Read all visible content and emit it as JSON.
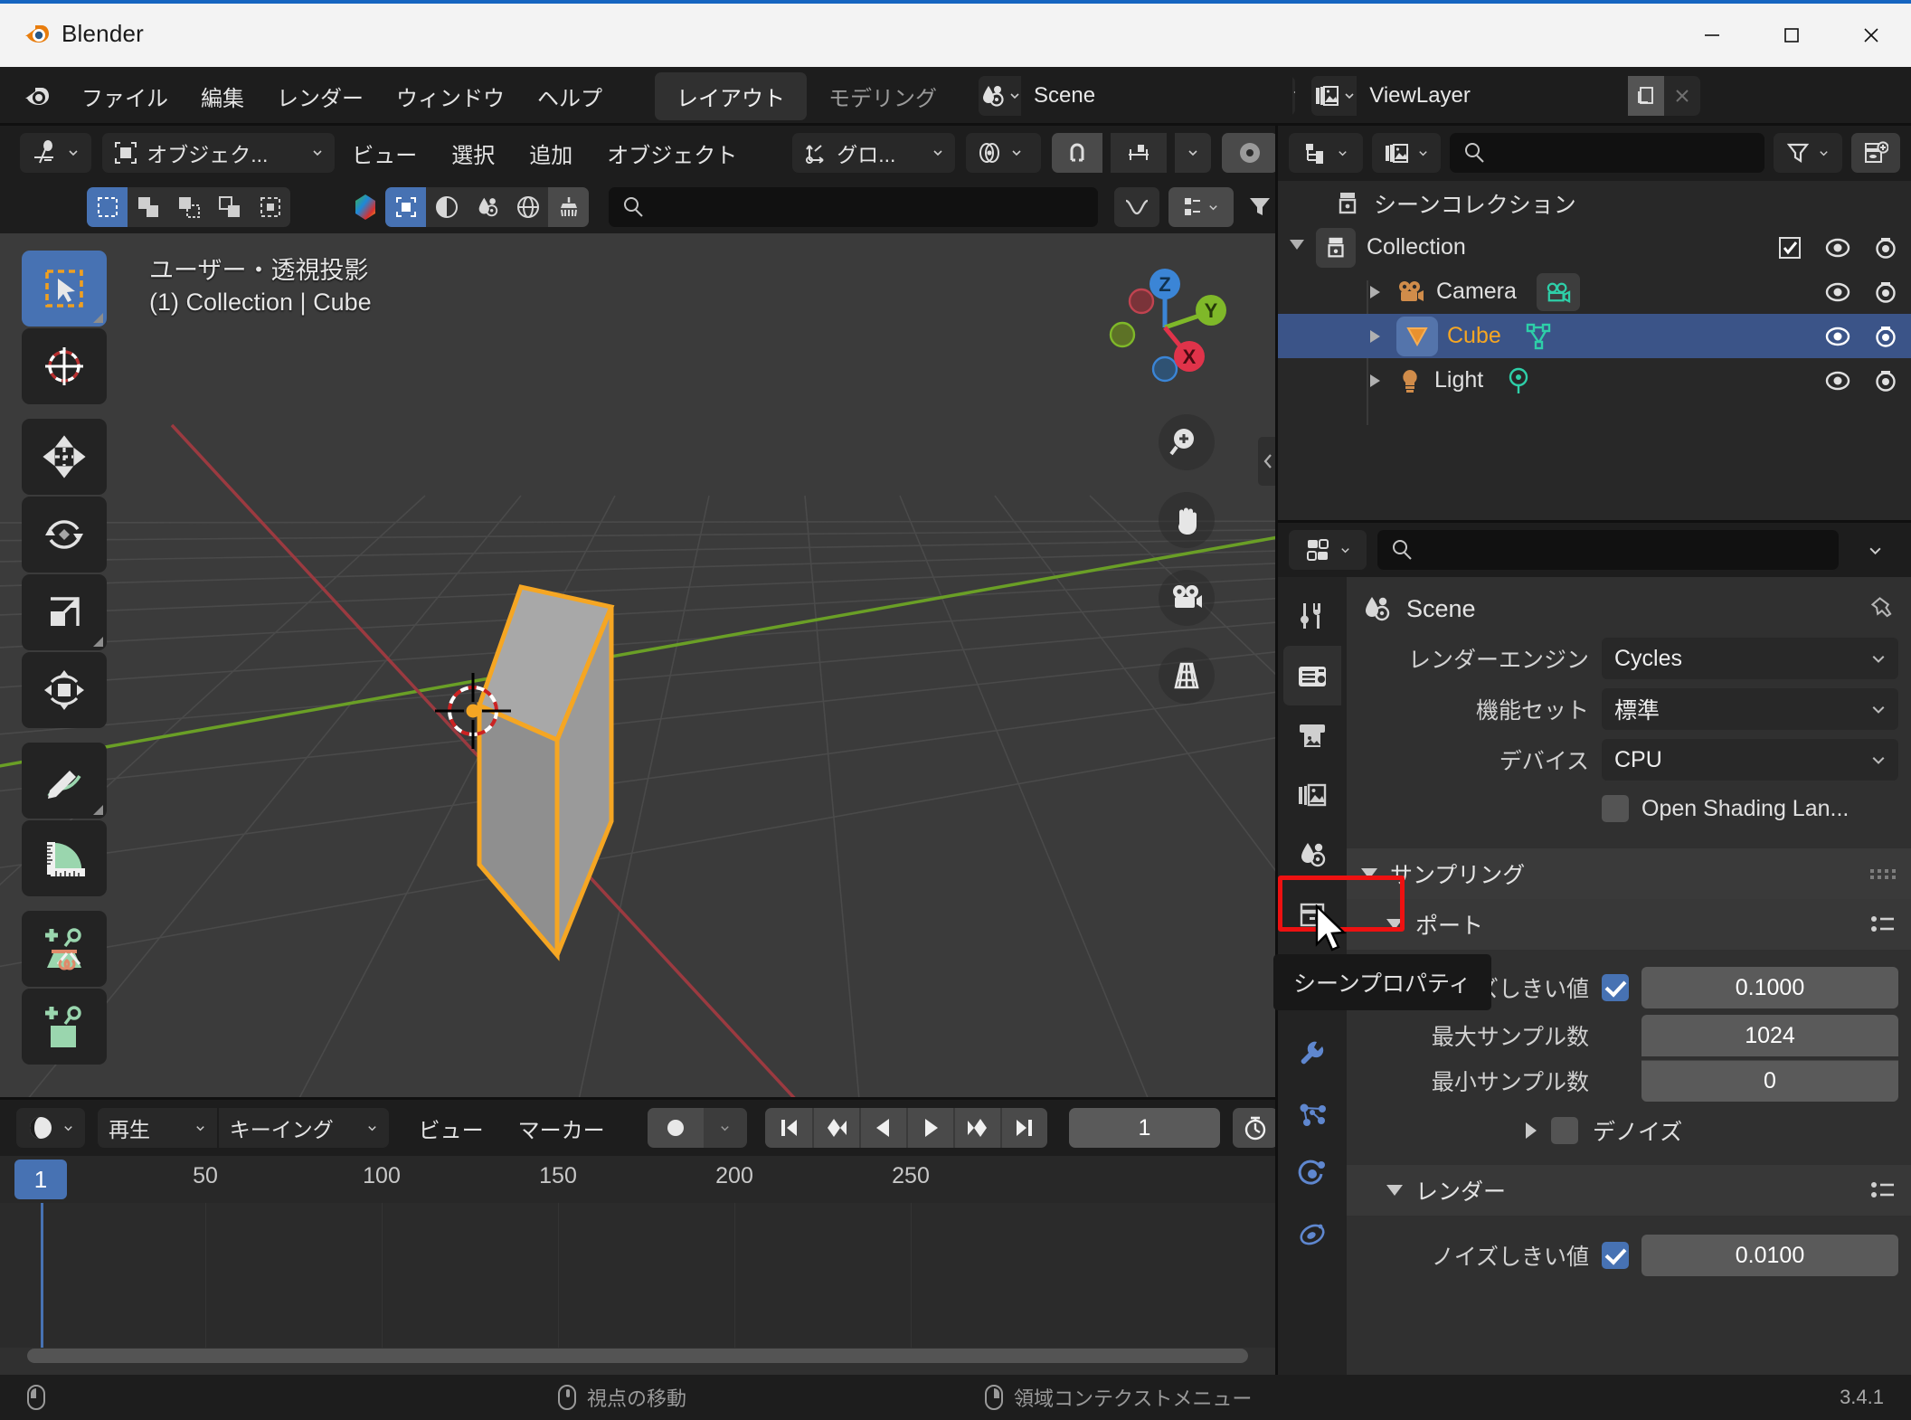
{
  "window": {
    "app_title": "Blender",
    "minimize": "─",
    "maximize": "☐",
    "close": "✕"
  },
  "topbar": {
    "menus": [
      "ファイル",
      "編集",
      "レンダー",
      "ウィンドウ",
      "ヘルプ"
    ],
    "workspaces": [
      {
        "label": "レイアウト",
        "active": true
      },
      {
        "label": "モデリング",
        "active": false
      }
    ],
    "scene_id": {
      "name": "Scene",
      "icon": "scene-icon"
    },
    "viewlayer_id": {
      "name": "ViewLayer",
      "icon": "viewlayer-icon"
    }
  },
  "viewport_header": {
    "editor_type": "editor-type-icon",
    "mode": "オブジェク...",
    "menus": [
      "ビュー",
      "選択",
      "追加",
      "オブジェクト"
    ],
    "transform_orientation": "グロ...",
    "snap_label": "snap-magnet-icon",
    "proportional_label": "proportional-edit-icon"
  },
  "tool_settings": {
    "select_modes": [
      "select-box",
      "select-extend",
      "select-subtract",
      "select-invert",
      "select-intersect"
    ],
    "mode_active_index": 0,
    "overlay_buttons": [
      "color-gradient-icon",
      "select-box-icon",
      "shading-icon",
      "scene-props-icon",
      "world-icon",
      "brush-icon"
    ],
    "search_placeholder": ""
  },
  "viewport": {
    "overlay_line1": "ユーザー・透視投影",
    "overlay_line2": "(1) Collection | Cube",
    "gizmo_axes": [
      "X",
      "Y",
      "Z"
    ],
    "nav_buttons": [
      "zoom-icon",
      "pan-hand-icon",
      "camera-view-icon",
      "perspective-toggle-icon"
    ],
    "tools": [
      "tweak-select-tool",
      "cursor-tool",
      "move-tool",
      "rotate-tool",
      "scale-tool",
      "transform-tool",
      "annotate-tool",
      "measure-tool",
      "add-cube-tool",
      "add-cube-tool-2"
    ],
    "object_name": "Cube",
    "outline_color": "#f5a623"
  },
  "timeline": {
    "editor_icon": "timeline-editor-icon",
    "menus": [
      "再生",
      "キーイング",
      "ビュー",
      "マーカー"
    ],
    "record_label": "auto-keying-icon",
    "transport": [
      "jump-start",
      "prev-keyframe",
      "play-reverse",
      "play",
      "next-keyframe",
      "jump-end"
    ],
    "current_frame": "1",
    "timer_icon": "stopwatch-icon",
    "ticks": [
      "50",
      "100",
      "150",
      "200",
      "250"
    ],
    "tick_positions": [
      227,
      422,
      617,
      812,
      1007
    ],
    "playhead_frame": "1"
  },
  "outliner": {
    "display_mode_icon": "outliner-display-mode-icon",
    "filter_id_icon": "filter-id-icon",
    "search_placeholder": "",
    "filter_icon": "filter-funnel-icon",
    "new_collection_icon": "new-collection-icon",
    "rows": [
      {
        "label": "シーンコレクション",
        "icon": "scene-collection-icon",
        "indent": 0,
        "expandable": false,
        "selected": false,
        "checkbox": false,
        "eye": false,
        "camera": false,
        "data_icon": null
      },
      {
        "label": "Collection",
        "icon": "collection-icon",
        "indent": 1,
        "expandable": true,
        "expanded": true,
        "selected": false,
        "checkbox": true,
        "eye": true,
        "camera": true,
        "data_icon": null
      },
      {
        "label": "Camera",
        "icon": "camera-object-icon",
        "indent": 2,
        "expandable": true,
        "expanded": false,
        "selected": false,
        "checkbox": false,
        "eye": true,
        "camera": true,
        "data_icon": "camera-data-icon"
      },
      {
        "label": "Cube",
        "icon": "mesh-object-icon",
        "indent": 2,
        "expandable": true,
        "expanded": false,
        "selected": true,
        "checkbox": false,
        "eye": true,
        "camera": true,
        "data_icon": "mesh-data-icon"
      },
      {
        "label": "Light",
        "icon": "light-object-icon",
        "indent": 2,
        "expandable": true,
        "expanded": false,
        "selected": false,
        "checkbox": false,
        "eye": true,
        "camera": true,
        "data_icon": "light-data-icon"
      }
    ]
  },
  "properties": {
    "editor_icon": "properties-editor-icon",
    "search_placeholder": "",
    "breadcrumb": "Scene",
    "breadcrumb_icon": "scene-icon",
    "pin_icon": "pin-icon",
    "tabs": [
      {
        "name": "tool-tab",
        "active": false
      },
      {
        "name": "render-tab",
        "active": true
      },
      {
        "name": "output-tab",
        "active": false
      },
      {
        "name": "viewlayer-tab",
        "active": false
      },
      {
        "name": "scene-tab",
        "active": false,
        "highlighted": true
      },
      {
        "name": "world-tab",
        "active": false
      },
      {
        "name": "object-tab",
        "active": false
      },
      {
        "name": "modifier-tab",
        "active": false
      },
      {
        "name": "particles-tab",
        "active": false
      },
      {
        "name": "physics-tab",
        "active": false
      },
      {
        "name": "constraint-tab",
        "active": false
      }
    ],
    "render_engine": {
      "label": "レンダーエンジン",
      "value": "Cycles"
    },
    "feature_set": {
      "label": "機能セット",
      "value": "標準"
    },
    "device": {
      "label": "デバイス",
      "value": "CPU"
    },
    "osl": {
      "label": "Open Shading Lan...",
      "checked": false
    },
    "sampling_panel": {
      "label": "サンプリング",
      "expanded": true
    },
    "viewport_panel": {
      "label": "ポート",
      "expanded": true
    },
    "viewport_fields": [
      {
        "label": "ノイズしきい値",
        "checkbox": true,
        "value": "0.1000"
      },
      {
        "label": "最大サンプル数",
        "checkbox": null,
        "value": "1024"
      },
      {
        "label": "最小サンプル数",
        "checkbox": null,
        "value": "0"
      }
    ],
    "denoise": {
      "label": "デノイズ",
      "checked": false,
      "expanded": false
    },
    "render_panel": {
      "label": "レンダー",
      "expanded": true
    },
    "render_fields": [
      {
        "label": "ノイズしきい値",
        "checkbox": true,
        "value": "0.0100"
      }
    ],
    "tooltip": "シーンプロパティ"
  },
  "statusbar": {
    "items": [
      {
        "icon": "mouse-left-icon",
        "label": ""
      },
      {
        "icon": "mouse-middle-icon",
        "label": "視点の移動"
      },
      {
        "icon": "mouse-right-icon",
        "label": "領域コンテクストメニュー"
      }
    ],
    "version": "3.4.1"
  }
}
